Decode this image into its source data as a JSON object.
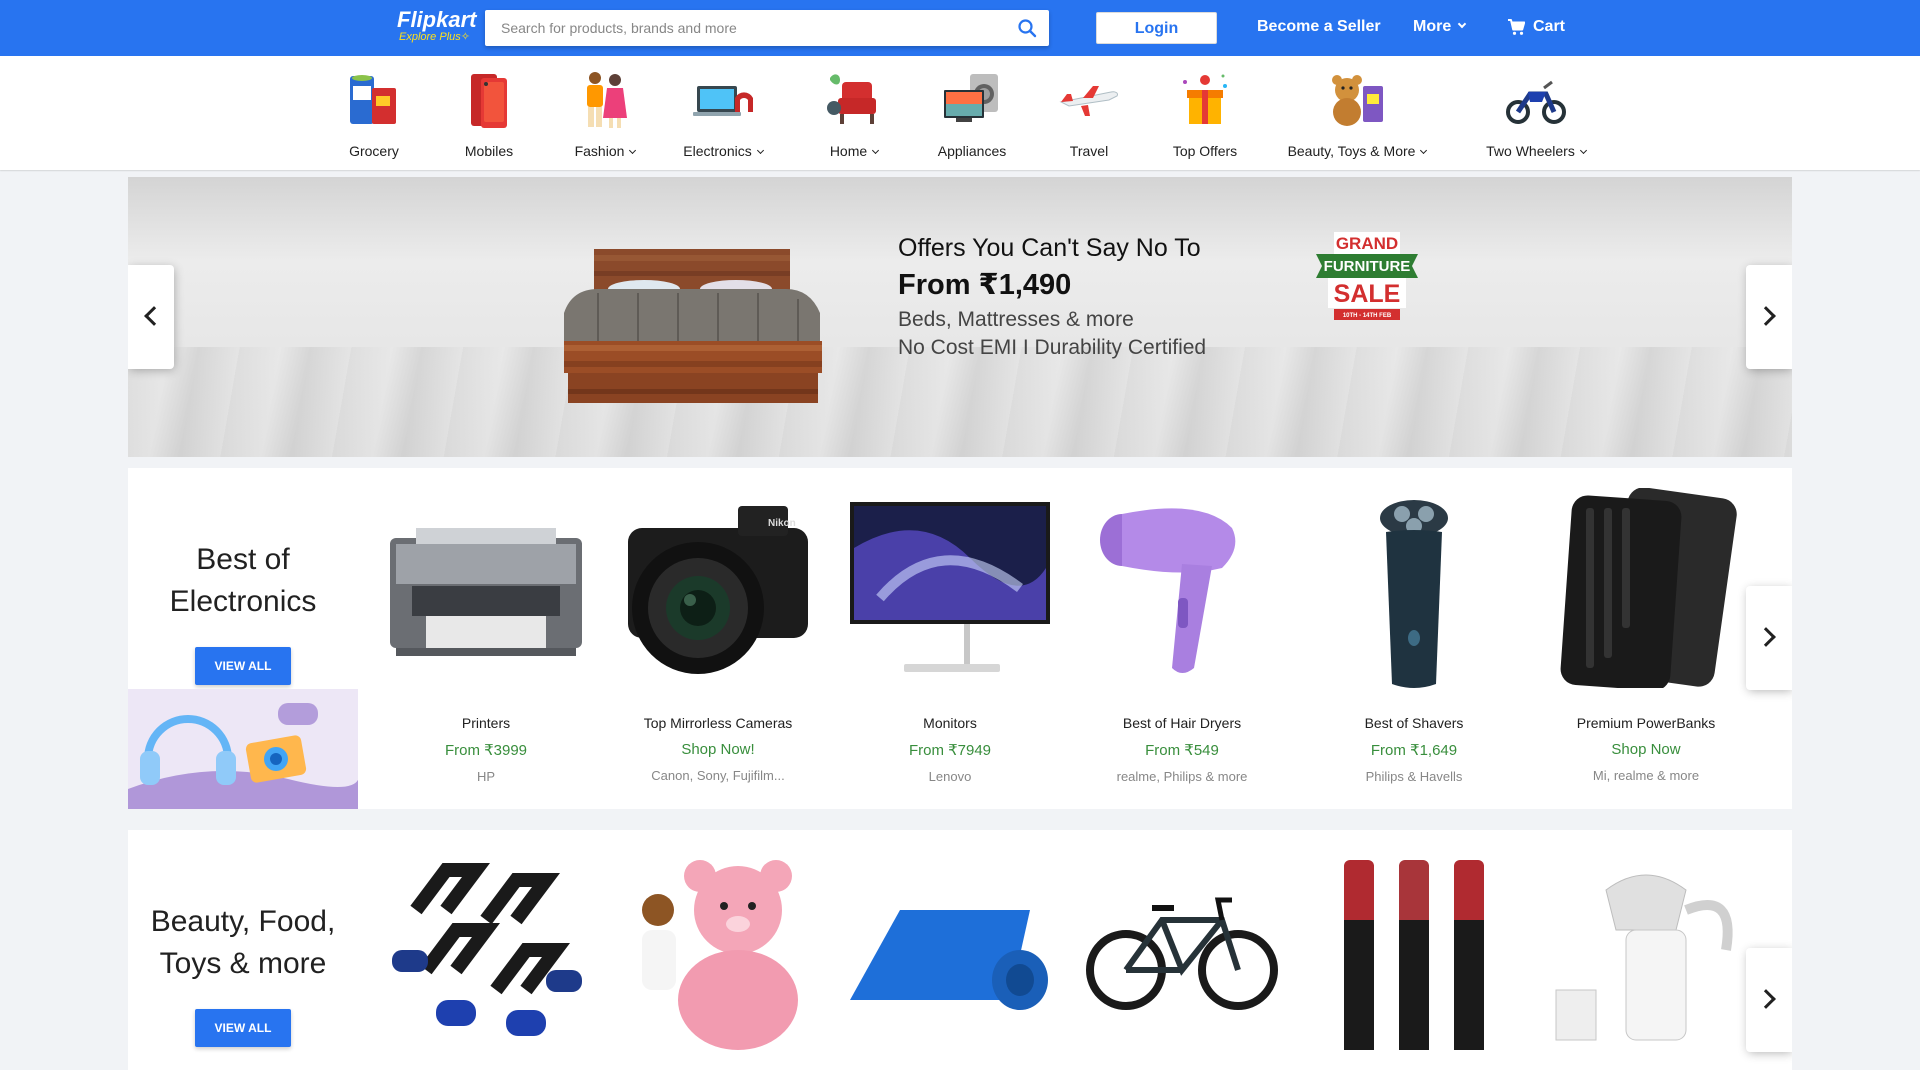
{
  "header": {
    "logo": "Flipkart",
    "logo_sub": "Explore Plus",
    "search_placeholder": "Search for products, brands and more",
    "login": "Login",
    "seller": "Become a Seller",
    "more": "More",
    "cart": "Cart",
    "brand_color": "#2874f0"
  },
  "categories": [
    {
      "label": "Grocery",
      "dropdown": false
    },
    {
      "label": "Mobiles",
      "dropdown": false
    },
    {
      "label": "Fashion",
      "dropdown": true
    },
    {
      "label": "Electronics",
      "dropdown": true
    },
    {
      "label": "Home",
      "dropdown": true
    },
    {
      "label": "Appliances",
      "dropdown": false
    },
    {
      "label": "Travel",
      "dropdown": false
    },
    {
      "label": "Top Offers",
      "dropdown": false
    },
    {
      "label": "Beauty, Toys & More",
      "dropdown": true
    },
    {
      "label": "Two Wheelers",
      "dropdown": true
    }
  ],
  "banner": {
    "title": "Offers You Can't Say No To",
    "price": "From ₹1,490",
    "line1": "Beds, Mattresses & more",
    "line2": "No Cost EMI I Durability Certified",
    "badge_top": "GRAND",
    "badge_mid": "FURNITURE",
    "badge_sale": "SALE",
    "badge_dates": "10TH - 14TH FEB"
  },
  "electronics": {
    "title": "Best of Electronics",
    "view_all": "VIEW ALL",
    "items": [
      {
        "name": "Printers",
        "offer": "From ₹3999",
        "sub": "HP"
      },
      {
        "name": "Top Mirrorless Cameras",
        "offer": "Shop Now!",
        "sub": "Canon, Sony, Fujifilm..."
      },
      {
        "name": "Monitors",
        "offer": "From ₹7949",
        "sub": "Lenovo"
      },
      {
        "name": "Best of Hair Dryers",
        "offer": "From ₹549",
        "sub": "realme, Philips & more"
      },
      {
        "name": "Best of Shavers",
        "offer": "From ₹1,649",
        "sub": "Philips & Havells"
      },
      {
        "name": "Premium PowerBanks",
        "offer": "Shop Now",
        "sub": "Mi, realme & more"
      }
    ]
  },
  "beauty": {
    "title": "Beauty, Food, Toys & more",
    "view_all": "VIEW ALL"
  }
}
